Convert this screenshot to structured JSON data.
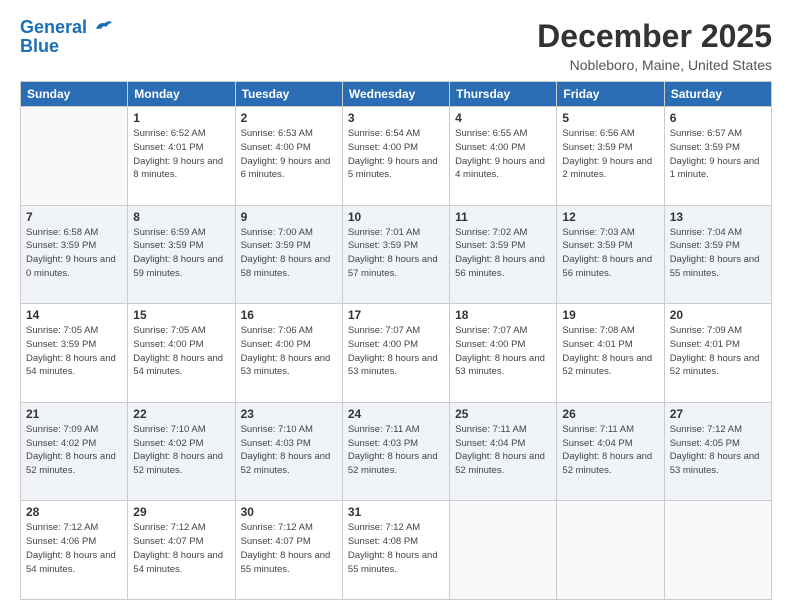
{
  "header": {
    "logo_line1": "General",
    "logo_line2": "Blue",
    "month_title": "December 2025",
    "location": "Nobleboro, Maine, United States"
  },
  "weekdays": [
    "Sunday",
    "Monday",
    "Tuesday",
    "Wednesday",
    "Thursday",
    "Friday",
    "Saturday"
  ],
  "weeks": [
    [
      {
        "day": "",
        "empty": true
      },
      {
        "day": "1",
        "sunrise": "6:52 AM",
        "sunset": "4:01 PM",
        "daylight": "9 hours and 8 minutes."
      },
      {
        "day": "2",
        "sunrise": "6:53 AM",
        "sunset": "4:00 PM",
        "daylight": "9 hours and 6 minutes."
      },
      {
        "day": "3",
        "sunrise": "6:54 AM",
        "sunset": "4:00 PM",
        "daylight": "9 hours and 5 minutes."
      },
      {
        "day": "4",
        "sunrise": "6:55 AM",
        "sunset": "4:00 PM",
        "daylight": "9 hours and 4 minutes."
      },
      {
        "day": "5",
        "sunrise": "6:56 AM",
        "sunset": "3:59 PM",
        "daylight": "9 hours and 2 minutes."
      },
      {
        "day": "6",
        "sunrise": "6:57 AM",
        "sunset": "3:59 PM",
        "daylight": "9 hours and 1 minute."
      }
    ],
    [
      {
        "day": "7",
        "sunrise": "6:58 AM",
        "sunset": "3:59 PM",
        "daylight": "9 hours and 0 minutes."
      },
      {
        "day": "8",
        "sunrise": "6:59 AM",
        "sunset": "3:59 PM",
        "daylight": "8 hours and 59 minutes."
      },
      {
        "day": "9",
        "sunrise": "7:00 AM",
        "sunset": "3:59 PM",
        "daylight": "8 hours and 58 minutes."
      },
      {
        "day": "10",
        "sunrise": "7:01 AM",
        "sunset": "3:59 PM",
        "daylight": "8 hours and 57 minutes."
      },
      {
        "day": "11",
        "sunrise": "7:02 AM",
        "sunset": "3:59 PM",
        "daylight": "8 hours and 56 minutes."
      },
      {
        "day": "12",
        "sunrise": "7:03 AM",
        "sunset": "3:59 PM",
        "daylight": "8 hours and 56 minutes."
      },
      {
        "day": "13",
        "sunrise": "7:04 AM",
        "sunset": "3:59 PM",
        "daylight": "8 hours and 55 minutes."
      }
    ],
    [
      {
        "day": "14",
        "sunrise": "7:05 AM",
        "sunset": "3:59 PM",
        "daylight": "8 hours and 54 minutes."
      },
      {
        "day": "15",
        "sunrise": "7:05 AM",
        "sunset": "4:00 PM",
        "daylight": "8 hours and 54 minutes."
      },
      {
        "day": "16",
        "sunrise": "7:06 AM",
        "sunset": "4:00 PM",
        "daylight": "8 hours and 53 minutes."
      },
      {
        "day": "17",
        "sunrise": "7:07 AM",
        "sunset": "4:00 PM",
        "daylight": "8 hours and 53 minutes."
      },
      {
        "day": "18",
        "sunrise": "7:07 AM",
        "sunset": "4:00 PM",
        "daylight": "8 hours and 53 minutes."
      },
      {
        "day": "19",
        "sunrise": "7:08 AM",
        "sunset": "4:01 PM",
        "daylight": "8 hours and 52 minutes."
      },
      {
        "day": "20",
        "sunrise": "7:09 AM",
        "sunset": "4:01 PM",
        "daylight": "8 hours and 52 minutes."
      }
    ],
    [
      {
        "day": "21",
        "sunrise": "7:09 AM",
        "sunset": "4:02 PM",
        "daylight": "8 hours and 52 minutes."
      },
      {
        "day": "22",
        "sunrise": "7:10 AM",
        "sunset": "4:02 PM",
        "daylight": "8 hours and 52 minutes."
      },
      {
        "day": "23",
        "sunrise": "7:10 AM",
        "sunset": "4:03 PM",
        "daylight": "8 hours and 52 minutes."
      },
      {
        "day": "24",
        "sunrise": "7:11 AM",
        "sunset": "4:03 PM",
        "daylight": "8 hours and 52 minutes."
      },
      {
        "day": "25",
        "sunrise": "7:11 AM",
        "sunset": "4:04 PM",
        "daylight": "8 hours and 52 minutes."
      },
      {
        "day": "26",
        "sunrise": "7:11 AM",
        "sunset": "4:04 PM",
        "daylight": "8 hours and 52 minutes."
      },
      {
        "day": "27",
        "sunrise": "7:12 AM",
        "sunset": "4:05 PM",
        "daylight": "8 hours and 53 minutes."
      }
    ],
    [
      {
        "day": "28",
        "sunrise": "7:12 AM",
        "sunset": "4:06 PM",
        "daylight": "8 hours and 54 minutes."
      },
      {
        "day": "29",
        "sunrise": "7:12 AM",
        "sunset": "4:07 PM",
        "daylight": "8 hours and 54 minutes."
      },
      {
        "day": "30",
        "sunrise": "7:12 AM",
        "sunset": "4:07 PM",
        "daylight": "8 hours and 55 minutes."
      },
      {
        "day": "31",
        "sunrise": "7:12 AM",
        "sunset": "4:08 PM",
        "daylight": "8 hours and 55 minutes."
      },
      {
        "day": "",
        "empty": true
      },
      {
        "day": "",
        "empty": true
      },
      {
        "day": "",
        "empty": true
      }
    ]
  ]
}
